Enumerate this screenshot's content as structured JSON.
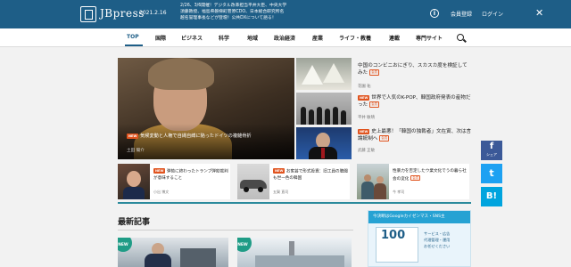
{
  "header": {
    "logo_text": "JBpress",
    "date": "2021.2.16",
    "ticker_lines": [
      "2/26、3/6開催！デジタル改革担当平井大臣、中央大学",
      "須藤教授、福島県磐梯町菅原CDO、日本総合研究所名",
      "越名誉理事長などが登壇！公共DXについて語る！"
    ],
    "register_label": "会員登録",
    "login_label": "ログイン",
    "info_icon": "info-icon",
    "close_icon": "close-icon"
  },
  "nav": {
    "items": [
      "TOP",
      "国際",
      "ビジネス",
      "科学",
      "地域",
      "政治経済",
      "産業",
      "ライフ・教養",
      "連載",
      "専門サイト"
    ],
    "active": "TOP",
    "search_icon": "search-icon"
  },
  "hero": {
    "badge": "NEW",
    "title": "気候変動と人権で自縄自縛に陥ったドイツの複雑骨折",
    "author": "土田 陽介"
  },
  "side_articles": [
    {
      "title": "中国のコンビニおにぎり、スカスカ度を検証してみた",
      "free": "会員",
      "author": "花園 祐"
    },
    {
      "title": "世界で人気のK-POP、韓国政府発表の産物だった",
      "free": "会員",
      "author": "平井 敏晴",
      "badge": "NEW"
    },
    {
      "title": "史上最悪！「韓国の独裁者」文在寅、次は言論統制へ",
      "free": "会員",
      "author": "武藤 正敏",
      "badge": "NEW"
    }
  ],
  "cards": [
    {
      "badge": "NEW",
      "title": "弾劾に終わったトランプ弾劾裁判が意味すること",
      "author": "小出 博文"
    },
    {
      "badge": "NEW",
      "title": "お家芸で形式投資：旧工員の聴聞も世一色の韓国",
      "author": "五賀 直司"
    },
    {
      "title": "性暴力を否定したウ業文化でうの暮ら社会の変化",
      "free": "会員",
      "author": "今 孝司"
    }
  ],
  "latest": {
    "title": "最新記事",
    "badge": "NEW"
  },
  "ad": {
    "header": "今決断はGoogleカイゼンマス・SNS主",
    "number": "100",
    "text_lines": [
      "サービス・広告",
      "代理管理・運用",
      "お任せください"
    ]
  },
  "share": {
    "facebook_glyph": "f",
    "facebook_label": "シェア",
    "twitter_glyph": "t",
    "hatena_glyph": "B!"
  },
  "colors": {
    "brand": "#1e5e87",
    "badge": "#e0541f",
    "facebook": "#3b5998",
    "twitter": "#1da1f2",
    "hatena": "#00a4de"
  }
}
